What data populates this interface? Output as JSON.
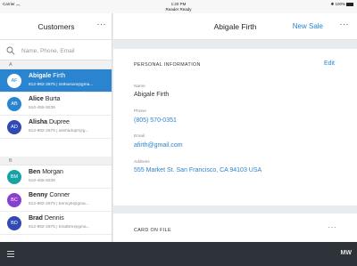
{
  "status_bar": {
    "carrier": "Carrier",
    "time": "1:20 PM",
    "reader_status": "Reader Ready",
    "battery": "100%"
  },
  "sidebar": {
    "title": "Customers",
    "more_label": "···",
    "search_placeholder": "Name, Phone, Email",
    "sections": [
      {
        "letter": "A"
      },
      {
        "letter": "B"
      }
    ],
    "customers": [
      {
        "initials": "AF",
        "first": "Abigale",
        "last": "Firth",
        "sub": "812-992-2875 | ssthoison@gma...",
        "color": "#2a84d0",
        "selected": true
      },
      {
        "initials": "AB",
        "first": "Alice",
        "last": "Burta",
        "sub": "510-455-9236",
        "color": "#2a84d0",
        "selected": false
      },
      {
        "initials": "AD",
        "first": "Alisha",
        "last": "Dupree",
        "sub": "812-992-2875 | alishadupr@g...",
        "color": "#2f49b5",
        "selected": false
      },
      {
        "initials": "BM",
        "first": "Ben",
        "last": "Morgan",
        "sub": "510-455-9236",
        "color": "#16a3a8",
        "selected": false
      },
      {
        "initials": "BC",
        "first": "Benny",
        "last": "Conner",
        "sub": "812-992-2875 | bennyb@gma...",
        "color": "#8a3fd1",
        "selected": false
      },
      {
        "initials": "BD",
        "first": "Brad",
        "last": "Dennis",
        "sub": "812-992-2875 | bradbre@gma...",
        "color": "#2f49b5",
        "selected": false
      }
    ]
  },
  "header": {
    "title": "Abigale Firth",
    "new_sale_label": "New Sale",
    "more_label": "···"
  },
  "personal_info": {
    "section_title": "PERSONAL INFORMATION",
    "edit_label": "Edit",
    "name_label": "Name",
    "name_value": "Abigale Firth",
    "phone_label": "Phone",
    "phone_value": "(805) 570-0351",
    "email_label": "Email",
    "email_value": "afirth@gmail.com",
    "address_label": "Address",
    "address_value": "555 Market St. San Francisco, CA 94103 USA"
  },
  "card_on_file": {
    "section_title": "CARD ON FILE",
    "more_label": "···"
  },
  "bottom_bar": {
    "initials": "MW"
  },
  "colors": {
    "accent": "#2a84d0",
    "bottom_bar": "#2d3339"
  }
}
